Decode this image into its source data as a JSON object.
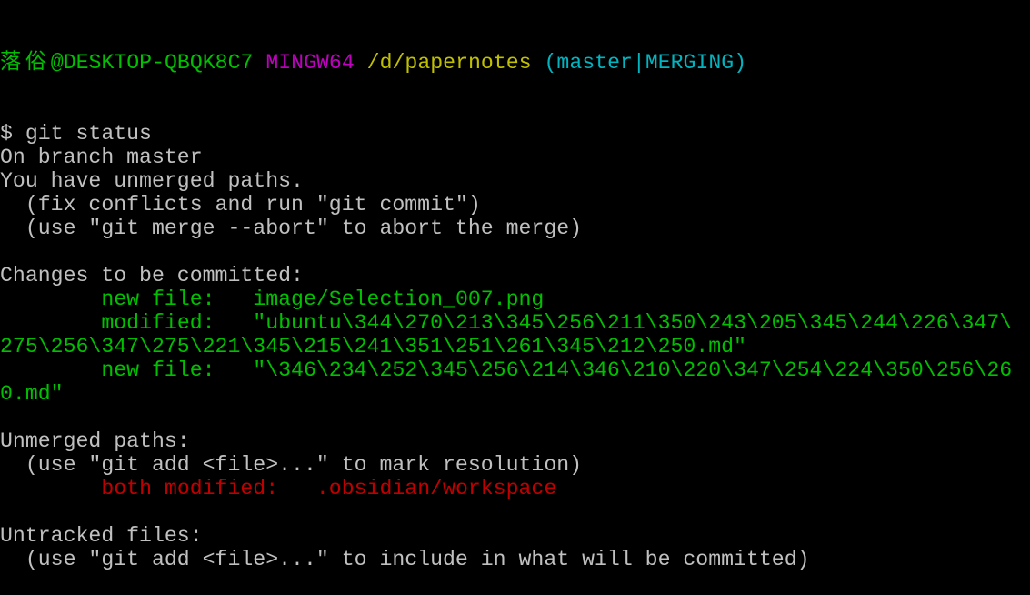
{
  "colors": {
    "default": "#c0c0c0",
    "green": "#00c000",
    "magenta": "#c000c0",
    "yellow": "#c0c000",
    "cyan": "#00b4c0",
    "red": "#c00000",
    "background": "#000000"
  },
  "prompt": {
    "user_host": "落俗@DESKTOP-QBQK8C7",
    "system": "MINGW64",
    "path": "/d/papernotes",
    "branch": "(master|MERGING)"
  },
  "lines": [
    [
      {
        "text": "$ git status",
        "color": "default"
      }
    ],
    [
      {
        "text": "On branch master",
        "color": "default"
      }
    ],
    [
      {
        "text": "You have unmerged paths.",
        "color": "default"
      }
    ],
    [
      {
        "text": "  (fix conflicts and run \"git commit\")",
        "color": "default"
      }
    ],
    [
      {
        "text": "  (use \"git merge --abort\" to abort the merge)",
        "color": "default"
      }
    ],
    [
      {
        "text": "",
        "color": "default"
      }
    ],
    [
      {
        "text": "Changes to be committed:",
        "color": "default"
      }
    ],
    [
      {
        "text": "        ",
        "color": "default"
      },
      {
        "text": "new file:   image/Selection_007.png",
        "color": "green"
      }
    ],
    [
      {
        "text": "        ",
        "color": "default"
      },
      {
        "text": "modified:   \"ubuntu\\344\\270\\213\\345\\256\\211\\350\\243\\205\\345\\244\\226\\347\\",
        "color": "green"
      }
    ],
    [
      {
        "text": "275\\256\\347\\275\\221\\345\\215\\241\\351\\251\\261\\345\\212\\250.md\"",
        "color": "green"
      }
    ],
    [
      {
        "text": "        ",
        "color": "default"
      },
      {
        "text": "new file:   \"\\346\\234\\252\\345\\256\\214\\346\\210\\220\\347\\254\\224\\350\\256\\26",
        "color": "green"
      }
    ],
    [
      {
        "text": "0.md\"",
        "color": "green"
      }
    ],
    [
      {
        "text": "",
        "color": "default"
      }
    ],
    [
      {
        "text": "Unmerged paths:",
        "color": "default"
      }
    ],
    [
      {
        "text": "  (use \"git add <file>...\" to mark resolution)",
        "color": "default"
      }
    ],
    [
      {
        "text": "        ",
        "color": "default"
      },
      {
        "text": "both modified:   .obsidian/workspace",
        "color": "red"
      }
    ],
    [
      {
        "text": "",
        "color": "default"
      }
    ],
    [
      {
        "text": "Untracked files:",
        "color": "default"
      }
    ],
    [
      {
        "text": "  (use \"git add <file>...\" to include in what will be committed)",
        "color": "default"
      }
    ]
  ]
}
